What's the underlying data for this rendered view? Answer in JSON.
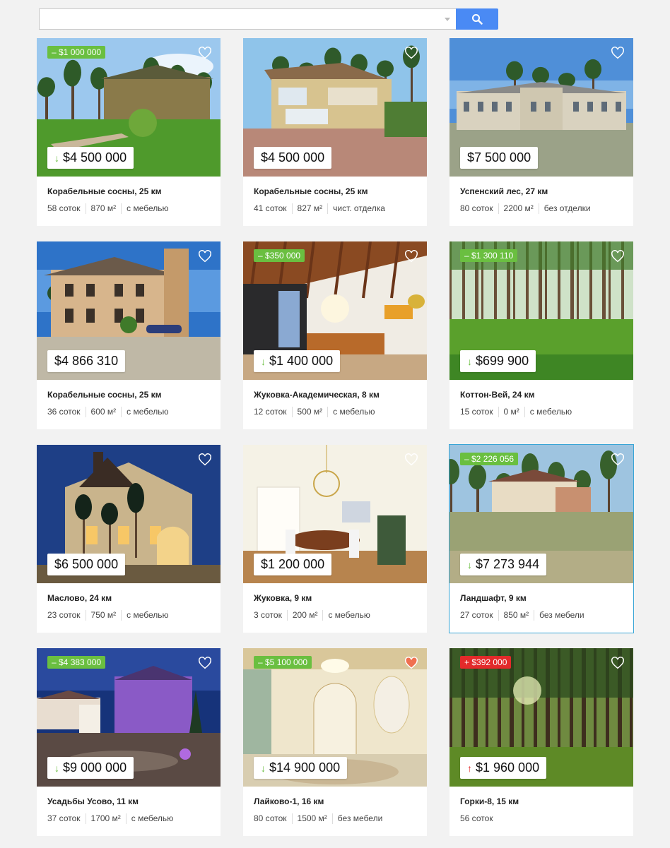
{
  "search": {
    "value": "",
    "placeholder": ""
  },
  "listings": [
    {
      "discount": "– $1 000 000",
      "discount_type": "green",
      "price": "$4 500 000",
      "trend": "down",
      "title": "Корабельные сосны, 25 км",
      "plot": "58 соток",
      "area": "870 м²",
      "finish": "с мебелью",
      "favorite": false,
      "scene": "forest-house"
    },
    {
      "discount": "",
      "discount_type": "",
      "price": "$4 500 000",
      "trend": "",
      "title": "Корабельные сосны, 25 км",
      "plot": "41 соток",
      "area": "827 м²",
      "finish": "чист. отделка",
      "favorite": false,
      "scene": "yellow-house"
    },
    {
      "discount": "",
      "discount_type": "",
      "price": "$7 500 000",
      "trend": "",
      "title": "Успенский лес, 27 км",
      "plot": "80 соток",
      "area": "2200 м²",
      "finish": "без отделки",
      "favorite": false,
      "scene": "mansion"
    },
    {
      "discount": "",
      "discount_type": "",
      "price": "$4 866 310",
      "trend": "",
      "title": "Корабельные сосны, 25 км",
      "plot": "36 соток",
      "area": "600 м²",
      "finish": "с мебелью",
      "favorite": false,
      "scene": "villa"
    },
    {
      "discount": "– $350 000",
      "discount_type": "green",
      "price": "$1 400 000",
      "trend": "down",
      "title": "Жуковка-Академическая, 8 км",
      "plot": "12 соток",
      "area": "500 м²",
      "finish": "с мебелью",
      "favorite": false,
      "scene": "interior-wood"
    },
    {
      "discount": "– $1 300 110",
      "discount_type": "green",
      "price": "$699 900",
      "trend": "down",
      "title": "Коттон-Вей, 24 км",
      "plot": "15 соток",
      "area": "0 м²",
      "finish": "с мебелью",
      "favorite": false,
      "scene": "pine-forest"
    },
    {
      "discount": "",
      "discount_type": "",
      "price": "$6 500 000",
      "trend": "",
      "title": "Маслово, 24 км",
      "plot": "23 соток",
      "area": "750 м²",
      "finish": "с мебелью",
      "favorite": false,
      "scene": "night-house"
    },
    {
      "discount": "",
      "discount_type": "",
      "price": "$1 200 000",
      "trend": "",
      "title": "Жуковка, 9 км",
      "plot": "3 соток",
      "area": "200 м²",
      "finish": "с мебелью",
      "favorite": false,
      "scene": "dining-room"
    },
    {
      "discount": "– $2 226 056",
      "discount_type": "green",
      "price": "$7 273 944",
      "trend": "down",
      "title": "Ландшафт, 9 км",
      "plot": "27 соток",
      "area": "850 м²",
      "finish": "без мебели",
      "favorite": false,
      "scene": "lawn-house",
      "active": true
    },
    {
      "discount": "– $4 383 000",
      "discount_type": "green",
      "price": "$9 000 000",
      "trend": "down",
      "title": "Усадьбы Усово, 11 км",
      "plot": "37 соток",
      "area": "1700 м²",
      "finish": "с мебелью",
      "favorite": false,
      "scene": "estate-night"
    },
    {
      "discount": "– $5 100 000",
      "discount_type": "green",
      "price": "$14 900 000",
      "trend": "down",
      "title": "Лайково-1, 16 км",
      "plot": "80 соток",
      "area": "1500 м²",
      "finish": "без мебели",
      "favorite": true,
      "scene": "marble-hall"
    },
    {
      "discount": "+ $392 000",
      "discount_type": "red",
      "price": "$1 960 000",
      "trend": "up",
      "title": "Горки-8, 15 км",
      "plot": "56 соток",
      "area": "",
      "finish": "",
      "favorite": false,
      "scene": "spruce-forest"
    }
  ],
  "colors": {
    "accent": "#4a8af4",
    "discount_green": "#6abf40",
    "discount_red": "#e32a2a",
    "favorite": "#f07050",
    "active_outline": "#3aa6d6"
  }
}
